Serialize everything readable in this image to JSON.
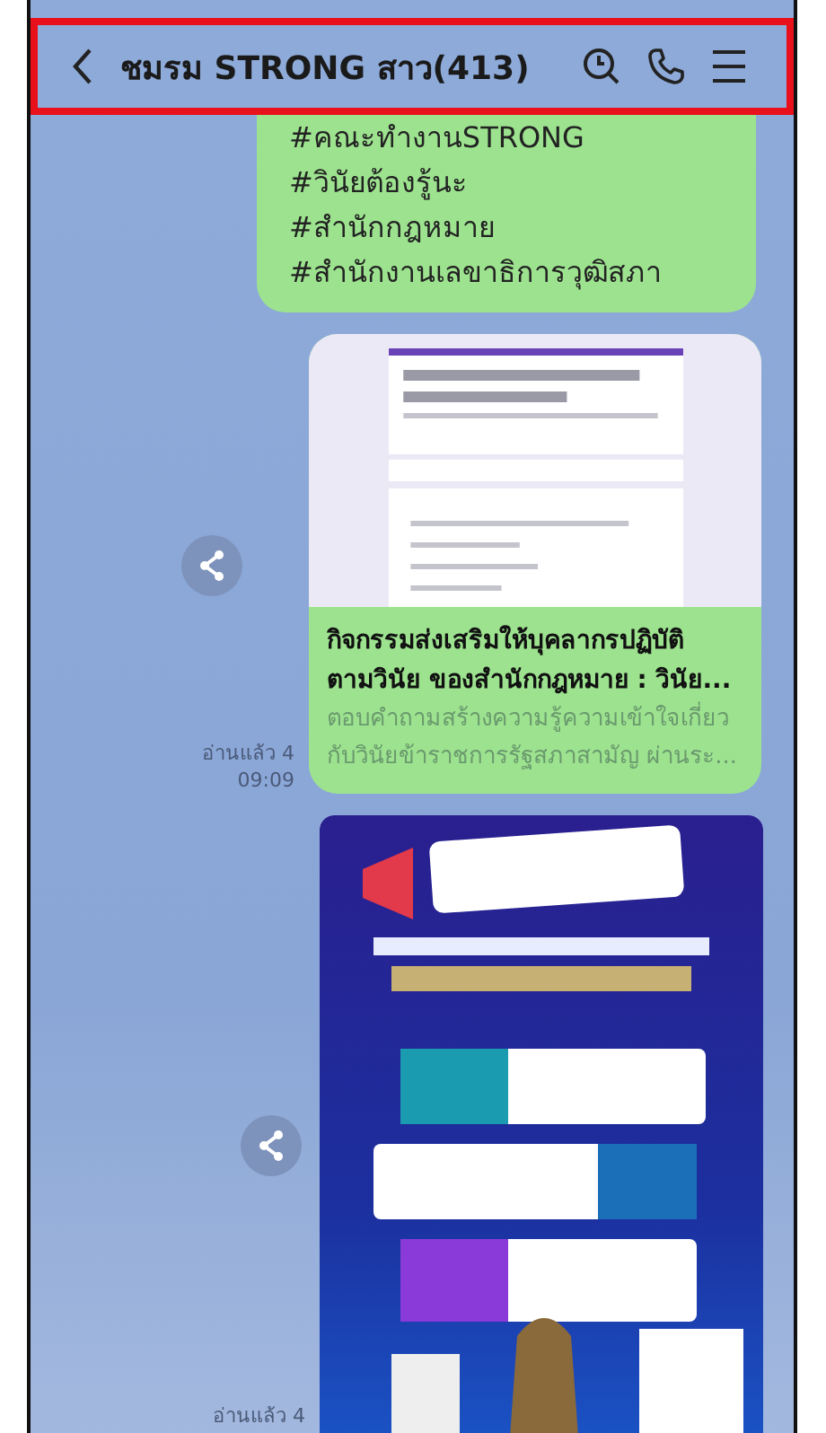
{
  "header": {
    "title": "ชมรม STRONG สาว(413)"
  },
  "messages": [
    {
      "kind": "text",
      "lines": [
        "#คณะทำงานSTRONG",
        "#วินัยต้องรู้นะ",
        "#สำนักกฎหมาย",
        "#สำนักงานเลขาธิการวุฒิสภา"
      ]
    },
    {
      "kind": "link",
      "preview": {
        "kind": "picture"
      },
      "title_lines": [
        "กิจกรรมส่งเสริมให้บุคลากรปฏิบัติ",
        "ตามวินัย ของสำนักกฎหมาย : วินัย..."
      ],
      "description_lines": [
        "ตอบคำถามสร้างความรู้ความเข้าใจเกี่ยว",
        "กับวินัยข้าราชการรัฐสภาสามัญ ผ่านระ..."
      ],
      "read": "อ่านแล้ว 4",
      "time": "09:09"
    },
    {
      "image": {
        "kind": "picture"
      },
      "read": "อ่านแล้ว 4"
    }
  ]
}
